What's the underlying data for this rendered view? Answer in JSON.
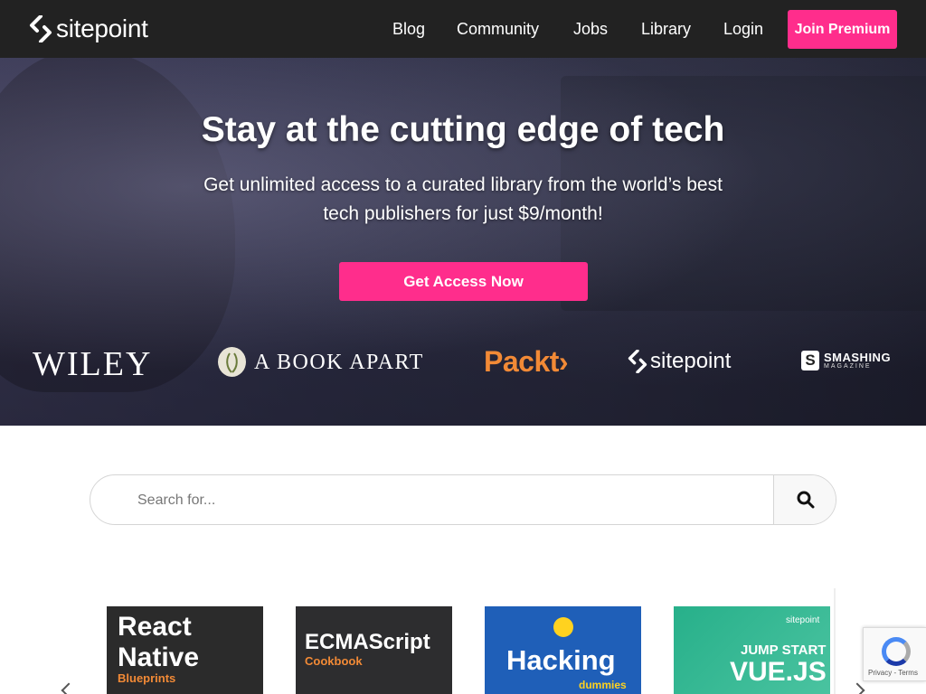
{
  "header": {
    "logo_text": "sitepoint",
    "nav": [
      "Blog",
      "Community",
      "Jobs",
      "Library",
      "Login"
    ],
    "cta_label": "Join Premium"
  },
  "hero": {
    "title": "Stay at the cutting edge of tech",
    "subtitle_line1": "Get unlimited access to a curated library from the world’s best",
    "subtitle_line2": "tech publishers for just $9/month!",
    "cta_label": "Get Access Now",
    "publishers": {
      "wiley": "WILEY",
      "bookapart": "A BOOK APART",
      "packt": "Packt›",
      "sitepoint": "sitepoint",
      "smashing_line1": "SMASHING",
      "smashing_line2": "MAGAZINE"
    }
  },
  "search": {
    "placeholder": "Search for..."
  },
  "books": [
    {
      "line1": "React",
      "line2": "Native",
      "line3": "Blueprints"
    },
    {
      "line1": "ECMAScript",
      "line2": "Cookbook"
    },
    {
      "line1": "Hacking",
      "line2": "dummies"
    },
    {
      "brand": "sitepoint",
      "line1": "JUMP START",
      "line2": "VUE.JS"
    }
  ],
  "recaptcha": {
    "links": "Privacy - Terms"
  },
  "colors": {
    "header_bg": "#222222",
    "accent_pink": "#ff2d8c",
    "packt_orange": "#f28a36"
  }
}
